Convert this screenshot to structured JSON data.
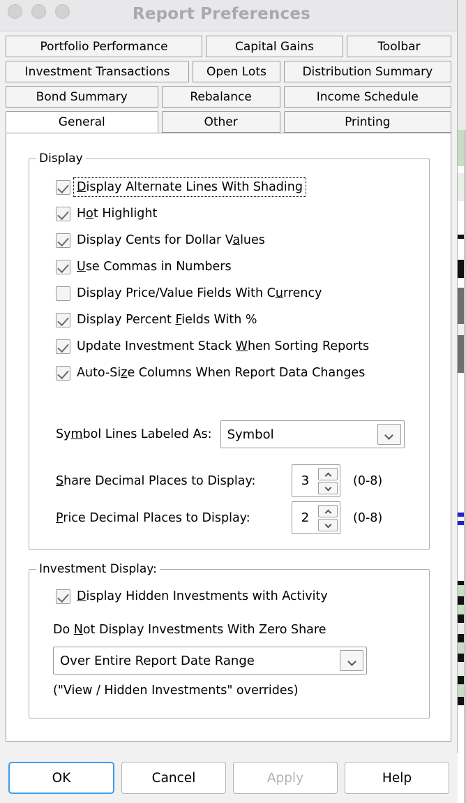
{
  "window": {
    "title": "Report Preferences",
    "traffic_lights": [
      "close-button",
      "minimize-button",
      "zoom-button"
    ]
  },
  "tabs": {
    "rows": [
      [
        {
          "label": "Portfolio Performance",
          "selected": false,
          "flex": 295
        },
        {
          "label": "Capital Gains",
          "selected": false,
          "flex": 205
        },
        {
          "label": "Toolbar",
          "selected": false,
          "flex": 156
        }
      ],
      [
        {
          "label": "Investment Transactions",
          "selected": false,
          "flex": 275
        },
        {
          "label": "Open Lots",
          "selected": false,
          "flex": 130
        },
        {
          "label": "Distribution Summary",
          "selected": false,
          "flex": 251
        }
      ],
      [
        {
          "label": "Bond Summary",
          "selected": false,
          "flex": 228
        },
        {
          "label": "Rebalance",
          "selected": false,
          "flex": 177
        },
        {
          "label": "Income Schedule",
          "selected": false,
          "flex": 251
        }
      ],
      [
        {
          "label": "General",
          "selected": true,
          "flex": 228
        },
        {
          "label": "Other",
          "selected": false,
          "flex": 177
        },
        {
          "label": "Printing",
          "selected": false,
          "flex": 251
        }
      ]
    ]
  },
  "display_group": {
    "title": "Display",
    "checkboxes": [
      {
        "label_pre": "",
        "mnemonic": "D",
        "label_post": "isplay Alternate Lines With Shading",
        "checked": true,
        "focused": true
      },
      {
        "label_pre": "H",
        "mnemonic": "o",
        "label_post": "t Highlight",
        "checked": true,
        "focused": false
      },
      {
        "label_pre": "Display Cents for Dollar V",
        "mnemonic": "a",
        "label_post": "lues",
        "checked": true,
        "focused": false
      },
      {
        "label_pre": "",
        "mnemonic": "U",
        "label_post": "se Commas in Numbers",
        "checked": true,
        "focused": false
      },
      {
        "label_pre": "Display Price/Value Fields With C",
        "mnemonic": "u",
        "label_post": "rrency",
        "checked": false,
        "focused": false
      },
      {
        "label_pre": "Display Percent ",
        "mnemonic": "F",
        "label_post": "ields With %",
        "checked": true,
        "focused": false
      },
      {
        "label_pre": "Update Investment Stack ",
        "mnemonic": "W",
        "label_post": "hen Sorting Reports",
        "checked": true,
        "focused": false
      },
      {
        "label_pre": "Auto-Si",
        "mnemonic": "z",
        "label_post": "e Columns When Report Data Changes",
        "checked": true,
        "focused": false
      }
    ],
    "symbol_lines": {
      "label_pre": "Sy",
      "mnemonic": "m",
      "label_post": "bol Lines Labeled As:",
      "value": "Symbol"
    },
    "share_decimal": {
      "label_pre": "",
      "mnemonic": "S",
      "label_post": "hare Decimal Places to Display:",
      "value": "3",
      "range_hint": "(0-8)"
    },
    "price_decimal": {
      "label_pre": "",
      "mnemonic": "P",
      "label_post": "rice Decimal Places to Display:",
      "value": "2",
      "range_hint": "(0-8)"
    }
  },
  "investment_group": {
    "title": "Investment Display:",
    "hidden_checkbox": {
      "label_pre": "",
      "mnemonic": "D",
      "label_post": "isplay Hidden Investments with Activity",
      "checked": true
    },
    "zero_share": {
      "label_pre": "Do ",
      "mnemonic": "N",
      "label_post": "ot Display Investments With Zero Share",
      "value": "Over Entire Report Date Range"
    },
    "note": "(\"View / Hidden Investments\" overrides)"
  },
  "footer": {
    "ok": "OK",
    "cancel": "Cancel",
    "apply": "Apply",
    "help": "Help"
  },
  "colors": {
    "dialog_bg": "#f1f1f1",
    "panel_bg": "#ffffff",
    "titlebar_bg": "#e8e8ea",
    "title_text": "#a9a9ae",
    "border": "#9a9a9a",
    "default_button_focus": "#3e9bf0",
    "disabled_text": "#b4b4b4"
  }
}
